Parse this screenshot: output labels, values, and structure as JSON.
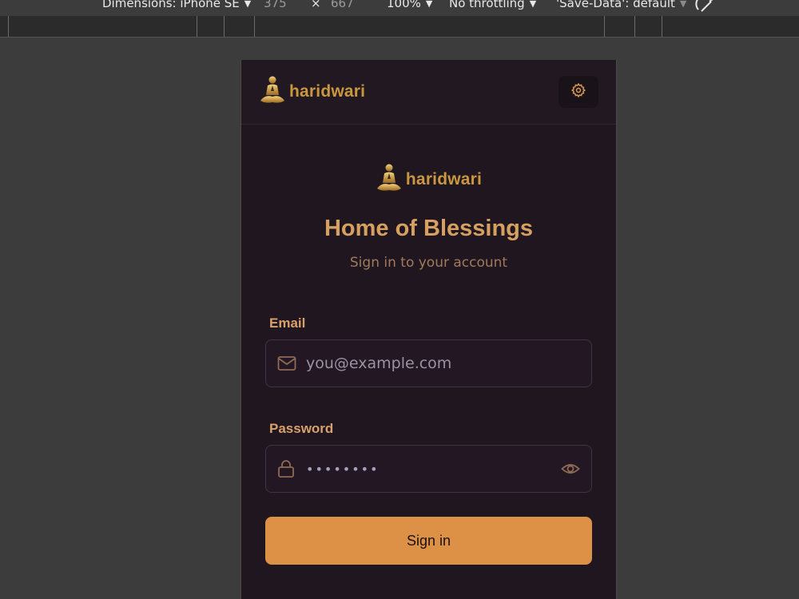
{
  "devtools": {
    "dimensions_label": "Dimensions: iPhone SE",
    "width": "375",
    "times": "×",
    "height": "667",
    "zoom": "100%",
    "throttling": "No throttling",
    "save_data": "'Save-Data': default"
  },
  "header": {
    "brand": "haridwari",
    "settings_icon": "gear-icon"
  },
  "hero": {
    "brand": "haridwari",
    "title": "Home of Blessings",
    "subtitle": "Sign in to your account"
  },
  "form": {
    "email_label": "Email",
    "email_placeholder": "you@example.com",
    "email_icon": "mail-icon",
    "password_label": "Password",
    "password_value": "password",
    "password_icon": "lock-icon",
    "reveal_icon": "eye-icon",
    "submit_label": "Sign in"
  },
  "colors": {
    "accent": "#dc9146",
    "brand_gold": "#c9973f",
    "background": "#201620",
    "label": "#d8a06a"
  }
}
